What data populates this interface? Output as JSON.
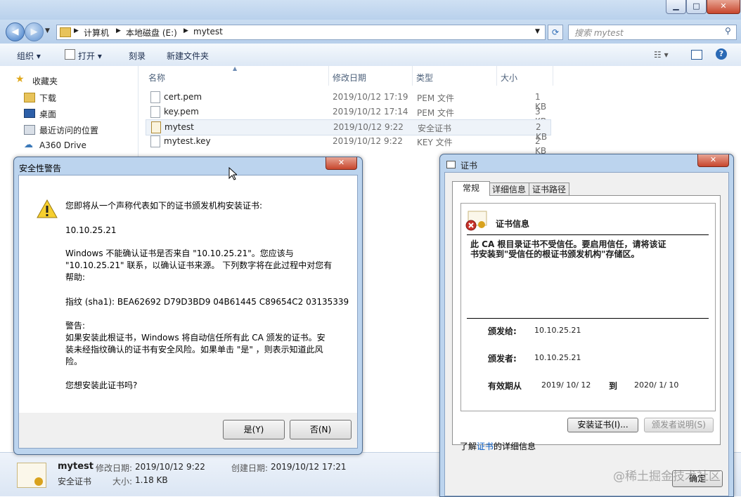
{
  "explorer": {
    "breadcrumb": [
      "计算机",
      "本地磁盘 (E:)",
      "mytest"
    ],
    "search_placeholder": "搜索 mytest",
    "toolbar": {
      "organize": "组织",
      "open": "打开",
      "burn": "刻录",
      "new_folder": "新建文件夹"
    },
    "nav": [
      {
        "label": "收藏夹",
        "icon": "star-icon"
      },
      {
        "label": "下载",
        "icon": "download-folder-icon"
      },
      {
        "label": "桌面",
        "icon": "desktop-icon"
      },
      {
        "label": "最近访问的位置",
        "icon": "recent-places-icon"
      },
      {
        "label": "A360 Drive",
        "icon": "cloud-drive-icon"
      }
    ],
    "columns": [
      "名称",
      "修改日期",
      "类型",
      "大小"
    ],
    "files": [
      {
        "name": "cert.pem",
        "date": "2019/10/12 17:19",
        "type": "PEM 文件",
        "size": "1 KB"
      },
      {
        "name": "key.pem",
        "date": "2019/10/12 17:14",
        "type": "PEM 文件",
        "size": "3 KB"
      },
      {
        "name": "mytest",
        "date": "2019/10/12 9:22",
        "type": "安全证书",
        "size": "2 KB"
      },
      {
        "name": "mytest.key",
        "date": "2019/10/12 9:22",
        "type": "KEY 文件",
        "size": "2 KB"
      }
    ],
    "details": {
      "name": "mytest",
      "type": "安全证书",
      "modified_label": "修改日期:",
      "modified": "2019/10/12 9:22",
      "created_label": "创建日期:",
      "created": "2019/10/12 17:21",
      "size_label": "大小:",
      "size": "1.18 KB"
    }
  },
  "security": {
    "title": "安全性警告",
    "intro": "您即将从一个声称代表如下的证书颁发机构安装证书:",
    "issuer": "10.10.25.21",
    "p1_l1": "Windows 不能确认证书是否来自 \"10.10.25.21\"。您应该与",
    "p1_l2": "\"10.10.25.21\" 联系，以确认证书来源。 下列数字将在此过程中对您有",
    "p1_l3": "帮助:",
    "thumbprint": "指纹 (sha1): BEA62692 D79D3BD9 04B61445 C89654C2 03135339",
    "warn_head": "警告:",
    "warn_l1": "如果安装此根证书，Windows 将自动信任所有此 CA 颁发的证书。安",
    "warn_l2": "装未经指纹确认的证书有安全风险。如果单击 \"是\" ，则表示知道此风",
    "warn_l3": "险。",
    "question": "您想安装此证书吗?",
    "yes": "是(Y)",
    "no": "否(N)"
  },
  "cert": {
    "title": "证书",
    "tabs": [
      "常规",
      "详细信息",
      "证书路径"
    ],
    "info_head": "证书信息",
    "untrusted_l1": "此 CA 根目录证书不受信任。要启用信任，请将该证",
    "untrusted_l2": "书安装到\"受信任的根证书颁发机构\"存储区。",
    "issued_to_label": "颁发给:",
    "issued_to": "10.10.25.21",
    "issued_by_label": "颁发者:",
    "issued_by": "10.10.25.21",
    "valid_label": "有效期从",
    "valid_from": "2019/ 10/ 12",
    "to_label": "到",
    "valid_to": "2020/ 1/ 10",
    "install_btn": "安装证书(I)...",
    "issuer_stmt_btn": "颁发者说明(S)",
    "learn_pre": "了解",
    "learn_link": "证书",
    "learn_post": "的详细信息",
    "ok": "确定"
  },
  "watermark": "@稀土掘金技术社区"
}
